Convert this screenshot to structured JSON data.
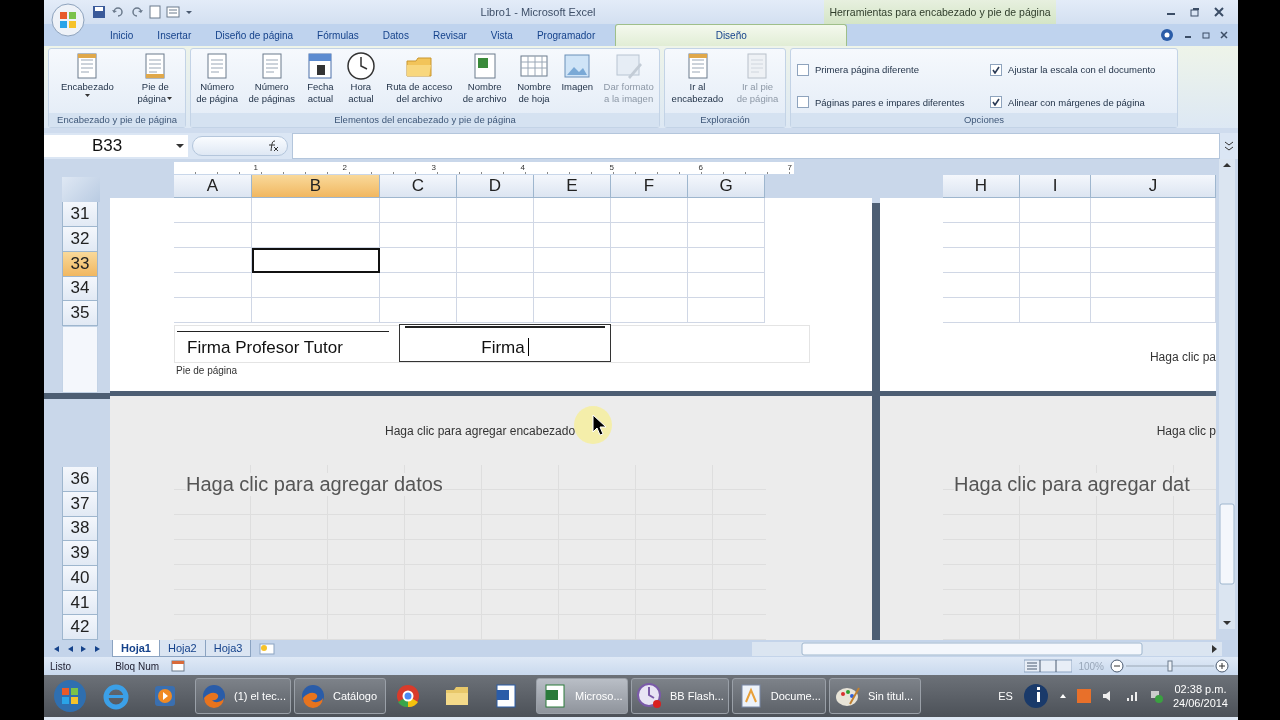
{
  "window": {
    "title": "Libro1 - Microsoft Excel",
    "context_title": "Herramientas para encabezado y pie de página"
  },
  "menu_tabs": [
    {
      "label": "Inicio",
      "selected": false,
      "kind": "standard"
    },
    {
      "label": "Insertar",
      "selected": false,
      "kind": "standard"
    },
    {
      "label": "Diseño de página",
      "selected": false,
      "kind": "standard"
    },
    {
      "label": "Fórmulas",
      "selected": false,
      "kind": "standard"
    },
    {
      "label": "Datos",
      "selected": false,
      "kind": "standard"
    },
    {
      "label": "Revisar",
      "selected": false,
      "kind": "standard"
    },
    {
      "label": "Vista",
      "selected": false,
      "kind": "standard"
    },
    {
      "label": "Programador",
      "selected": false,
      "kind": "standard"
    },
    {
      "label": "Diseño",
      "selected": true,
      "kind": "context"
    }
  ],
  "ribbon": {
    "groups": [
      {
        "label": "Encabezado y pie de página",
        "buttons": [
          {
            "lines": [
              "Encabezado"
            ],
            "kind": "header",
            "dropdown": true,
            "disabled": false
          },
          {
            "lines": [
              "Pie de",
              "página"
            ],
            "kind": "footer",
            "dropdown": true,
            "disabled": false
          }
        ]
      },
      {
        "label": "Elementos del encabezado y pie de página",
        "buttons": [
          {
            "lines": [
              "Número",
              "de página"
            ],
            "kind": "page",
            "dropdown": false,
            "disabled": false
          },
          {
            "lines": [
              "Número",
              "de páginas"
            ],
            "kind": "page",
            "dropdown": false,
            "disabled": false
          },
          {
            "lines": [
              "Fecha",
              "actual"
            ],
            "kind": "calendar",
            "dropdown": false,
            "disabled": false
          },
          {
            "lines": [
              "Hora",
              "actual"
            ],
            "kind": "clock",
            "dropdown": false,
            "disabled": false
          },
          {
            "lines": [
              "Ruta de acceso",
              "del archivo"
            ],
            "kind": "folder",
            "dropdown": false,
            "disabled": false
          },
          {
            "lines": [
              "Nombre",
              "de archivo"
            ],
            "kind": "spreadsheet",
            "dropdown": false,
            "disabled": false
          },
          {
            "lines": [
              "Nombre",
              "de hoja"
            ],
            "kind": "table",
            "dropdown": false,
            "disabled": false
          },
          {
            "lines": [
              "Imagen"
            ],
            "kind": "picture",
            "dropdown": false,
            "disabled": false
          },
          {
            "lines": [
              "Dar formato",
              "a la imagen"
            ],
            "kind": "brush",
            "dropdown": false,
            "disabled": true
          }
        ]
      },
      {
        "label": "Exploración",
        "buttons": [
          {
            "lines": [
              "Ir al",
              "encabezado"
            ],
            "kind": "header",
            "dropdown": false,
            "disabled": false
          },
          {
            "lines": [
              "Ir al pie",
              "de página"
            ],
            "kind": "page",
            "dropdown": false,
            "disabled": true
          }
        ]
      }
    ],
    "options": {
      "label": "Opciones",
      "checkboxes": [
        {
          "label": "Primera página diferente",
          "checked": false
        },
        {
          "label": "Páginas pares e impares diferentes",
          "checked": false
        },
        {
          "label": "Ajustar la escala con el documento",
          "checked": true
        },
        {
          "label": "Alinear con márgenes de página",
          "checked": true
        }
      ]
    }
  },
  "formula_bar": {
    "name_box": "B33"
  },
  "sheet": {
    "ruler_labels": [
      "1",
      "2",
      "3",
      "4",
      "5",
      "6",
      "7"
    ],
    "left_page": {
      "columns": [
        {
          "label": "A",
          "selected": false
        },
        {
          "label": "B",
          "selected": true
        },
        {
          "label": "C",
          "selected": false
        },
        {
          "label": "D",
          "selected": false
        },
        {
          "label": "E",
          "selected": false
        },
        {
          "label": "F",
          "selected": false
        },
        {
          "label": "G",
          "selected": false
        }
      ],
      "footer": {
        "left": "Firma Profesor Tutor",
        "center": "Firma",
        "caption": "Pie de página"
      }
    },
    "right_page": {
      "columns": [
        {
          "label": "H",
          "selected": false
        },
        {
          "label": "I",
          "selected": false
        },
        {
          "label": "J",
          "selected": false
        }
      ],
      "footer": "Haga clic pa"
    },
    "rows": [
      {
        "label": "31",
        "selected": false
      },
      {
        "label": "32",
        "selected": false
      },
      {
        "label": "33",
        "selected": true
      },
      {
        "label": "34",
        "selected": false
      },
      {
        "label": "35",
        "selected": false
      }
    ],
    "lower_left_page": {
      "header_prompt": "Haga clic para agregar encabezado",
      "data_prompt": "Haga clic para agregar datos"
    },
    "lower_right_page": {
      "header_prompt": "Haga clic p",
      "data_prompt": "Haga clic para agregar dat"
    },
    "lower_rows": [
      "36",
      "37",
      "38",
      "39",
      "40",
      "41",
      "42"
    ]
  },
  "sheet_tabs": [
    {
      "label": "Hoja1",
      "selected": true
    },
    {
      "label": "Hoja2",
      "selected": false
    },
    {
      "label": "Hoja3",
      "selected": false
    }
  ],
  "status_bar": {
    "ready": "Listo",
    "num_lock": "Bloq Num",
    "zoom": "100%",
    "zoom_slider": {
      "level": 0.5
    }
  },
  "taskbar": {
    "items": [
      {
        "kind": "start",
        "selected": false
      },
      {
        "kind": "ie",
        "selected": false
      },
      {
        "kind": "media",
        "selected": false
      },
      {
        "kind": "firefox",
        "label": "(1) el tec...",
        "selected": false
      },
      {
        "kind": "firefox",
        "label": "Catálogo",
        "selected": false
      },
      {
        "kind": "chrome",
        "selected": false
      },
      {
        "kind": "folder",
        "selected": false
      },
      {
        "kind": "word",
        "selected": false
      },
      {
        "kind": "excel",
        "label": "Microso...",
        "selected": true
      },
      {
        "kind": "bb",
        "label": "BB Flash...",
        "selected": false
      },
      {
        "kind": "doc",
        "label": "Docume...",
        "selected": false
      },
      {
        "kind": "paint",
        "label": "Sin titul...",
        "selected": false
      }
    ],
    "tray": {
      "language": "ES",
      "time": "02:38 p.m.",
      "date": "24/06/2014"
    }
  }
}
